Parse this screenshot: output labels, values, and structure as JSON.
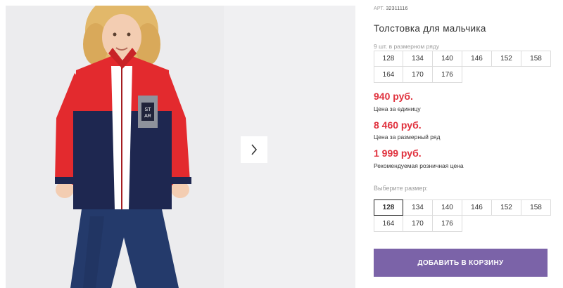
{
  "product": {
    "sku_label": "АРТ.",
    "sku_value": "32311116",
    "title": "Толстовка для мальчика",
    "logo_text": [
      "ST",
      "AR"
    ]
  },
  "size_set": {
    "count_label": "9 шт. в размерном ряду",
    "sizes": [
      "128",
      "134",
      "140",
      "146",
      "152",
      "158",
      "164",
      "170",
      "176"
    ]
  },
  "prices": {
    "unit_price": "940 руб.",
    "unit_label": "Цена за единицу",
    "set_price": "8 460 руб.",
    "set_label": "Цена за размерный ряд",
    "retail_price": "1 999 руб.",
    "retail_label": "Рекомендуемая розничная цена",
    "price_color": "#e0313d"
  },
  "size_picker": {
    "label": "Выберите размер:",
    "selected": "128",
    "sizes": [
      "128",
      "134",
      "140",
      "146",
      "152",
      "158",
      "164",
      "170",
      "176"
    ]
  },
  "actions": {
    "add_to_cart": "ДОБАВИТЬ В КОРЗИНУ",
    "button_color": "#7b63a8"
  },
  "gallery": {
    "next_icon": "chevron-right-icon"
  }
}
